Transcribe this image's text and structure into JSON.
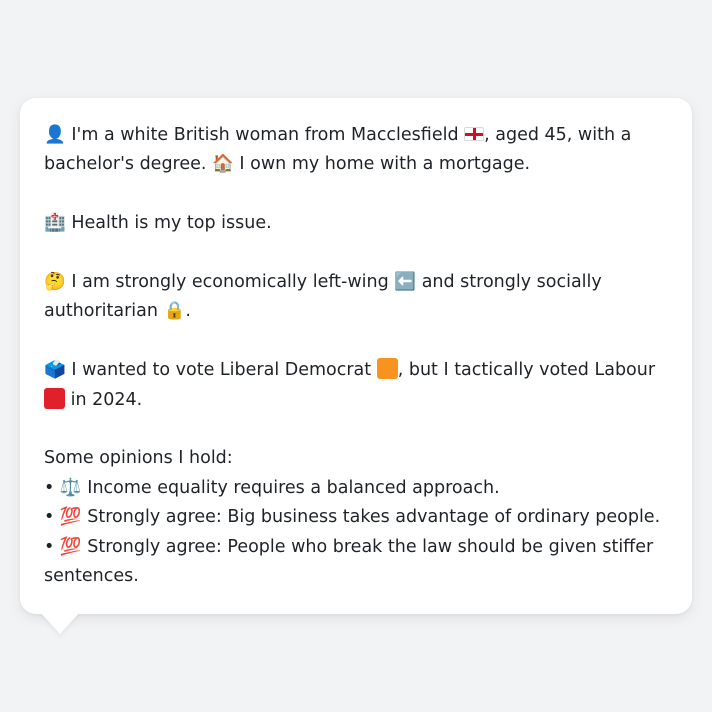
{
  "profile": {
    "p1": {
      "icon": "👤",
      "text_a": "I'm a white British woman from Macclesfield",
      "flag": "england-flag",
      "text_b": ", aged 45, with a bachelor's degree.",
      "home_icon": "🏠",
      "text_c": "I own my home with a mortgage."
    },
    "p2": {
      "icon": "🏥",
      "text": "Health is my top issue."
    },
    "p3": {
      "icon": "🤔",
      "text_a": "I am strongly economically left-wing",
      "left_icon": "⬅️",
      "text_b": "and strongly socially authoritarian",
      "lock_icon": "🔒",
      "text_c": "."
    },
    "p4": {
      "icon": "🗳️",
      "text_a": "I wanted to vote Liberal Democrat",
      "libdem_color": "#f7931e",
      "text_b": ", but I tactically voted Labour",
      "labour_color": "#e0202a",
      "text_c": "in 2024."
    },
    "opinions_heading": "Some opinions I hold:",
    "opinions": [
      {
        "bullet": "•",
        "icon": "⚖️",
        "text": "Income equality requires a balanced approach."
      },
      {
        "bullet": "•",
        "icon": "💯",
        "text": "Strongly agree: Big business takes advantage of ordinary people."
      },
      {
        "bullet": "•",
        "icon": "💯",
        "text": "Strongly agree: People who break the law should be given stiffer sentences."
      }
    ]
  },
  "colors": {
    "background": "#f2f3f5",
    "card": "#ffffff",
    "text": "#1f2328"
  }
}
